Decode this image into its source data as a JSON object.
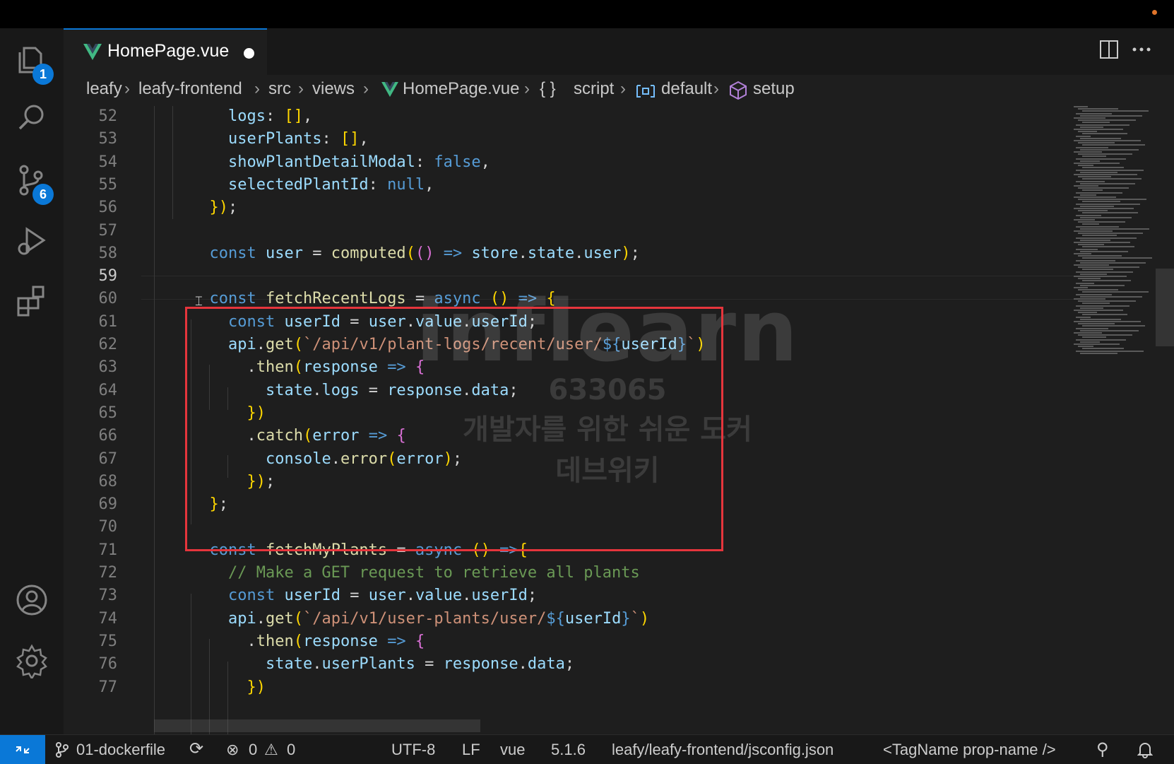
{
  "tab": {
    "filename": "HomePage.vue"
  },
  "breadcrumb": {
    "items": [
      "leafy",
      "leafy-frontend",
      "src",
      "views",
      "HomePage.vue",
      "script",
      "default",
      "setup"
    ]
  },
  "activity_badges": {
    "explorer": "1",
    "source_control": "6"
  },
  "line_numbers": [
    "52",
    "53",
    "54",
    "55",
    "56",
    "57",
    "58",
    "59",
    "60",
    "61",
    "62",
    "63",
    "64",
    "65",
    "66",
    "67",
    "68",
    "69",
    "70",
    "71",
    "72",
    "73",
    "74",
    "75",
    "76",
    "77"
  ],
  "active_line": "59",
  "code_lines": [
    "    logs: [],",
    "    userPlants: [],",
    "    showPlantDetailModal: false,",
    "    selectedPlantId: null,",
    "  });",
    "",
    "  const user = computed(() => store.state.user);",
    "",
    "  const fetchRecentLogs = async () => {",
    "    const userId = user.value.userId;",
    "    api.get(`/api/v1/plant-logs/recent/user/${userId}`)",
    "      .then(response => {",
    "        state.logs = response.data;",
    "      })",
    "      .catch(error => {",
    "        console.error(error);",
    "      });",
    "  };",
    "",
    "  const fetchMyPlants = async () =>{",
    "    // Make a GET request to retrieve all plants",
    "    const userId = user.value.userId;",
    "    api.get(`/api/v1/user-plants/user/${userId}`)",
    "      .then(response => {",
    "        state.userPlants = response.data;",
    "      })"
  ],
  "watermark": {
    "logo": "inflearn",
    "number": "633065",
    "line1": "개발자를 위한 쉬운 도커",
    "line2": "데브위키"
  },
  "statusbar": {
    "branch": "01-dockerfile",
    "errors": "0",
    "warnings": "0",
    "encoding": "UTF-8",
    "eol": "LF",
    "language": "vue",
    "version": "5.1.6",
    "config": "leafy/leafy-frontend/jsconfig.json",
    "tag_hint": "<TagName prop-name />"
  },
  "colors": {
    "accent": "#0a78d7",
    "highlight_box": "#e5353c",
    "vue_green": "#41b883"
  }
}
